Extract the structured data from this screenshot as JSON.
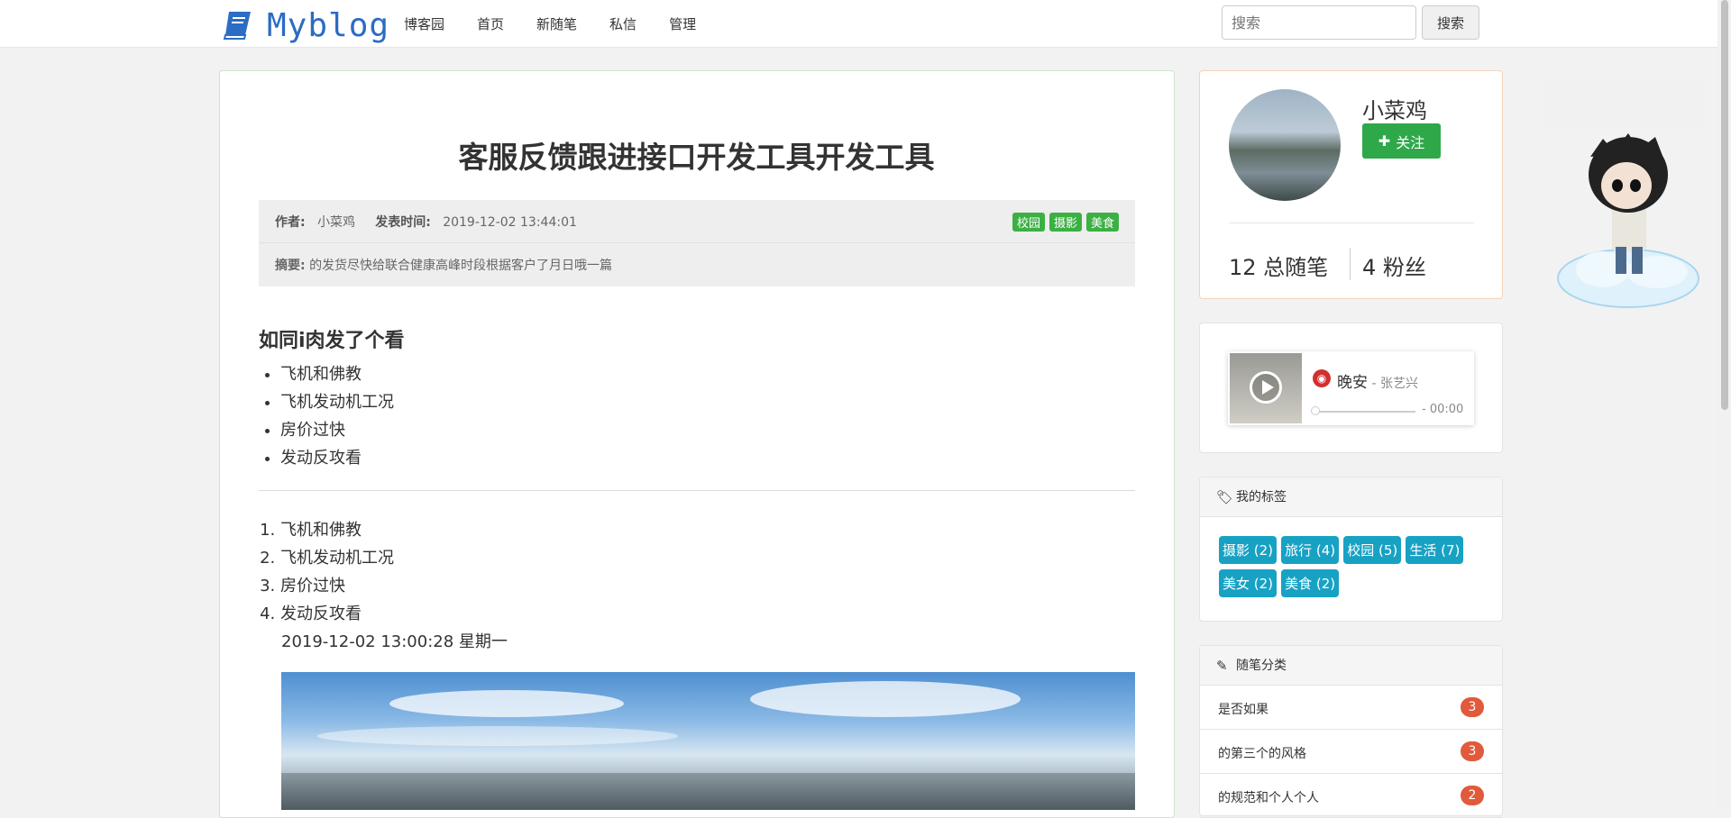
{
  "header": {
    "brand": "Myblog",
    "nav": [
      "博客园",
      "首页",
      "新随笔",
      "私信",
      "管理"
    ],
    "search_placeholder": "搜索",
    "search_button": "搜索"
  },
  "article": {
    "title": "客服反馈跟进接口开发工具开发工具",
    "author_label": "作者:",
    "author": "小菜鸡",
    "time_label": "发表时间:",
    "time": "2019-12-02 13:44:01",
    "tags": [
      "校园",
      "摄影",
      "美食"
    ],
    "summary_label": "摘要:",
    "summary": "的发货尽快给联合健康高峰时段根据客户了月日哦一篇",
    "heading": "如同i肉发了个看",
    "bullets": [
      "飞机和佛教",
      "飞机发动机工况",
      "房价过快",
      "发动反攻看"
    ],
    "ordered": [
      "飞机和佛教",
      "飞机发动机工况",
      "房价过快",
      "发动反攻看"
    ],
    "datetime": "2019-12-02 13:00:28 星期一"
  },
  "profile": {
    "name": "小菜鸡",
    "follow_label": "关注",
    "posts_stat": "12 总随笔",
    "fans_stat": "4 粉丝"
  },
  "music": {
    "song": "晚安",
    "artist": " - 张艺兴",
    "time": "- 00:00"
  },
  "tags_panel": {
    "title": "我的标签",
    "items": [
      "摄影 (2)",
      "旅行 (4)",
      "校园 (5)",
      "生活 (7)",
      "美女 (2)",
      "美食 (2)"
    ]
  },
  "categories_panel": {
    "title": "随笔分类",
    "items": [
      {
        "label": "是否如果",
        "count": "3"
      },
      {
        "label": "的第三个的风格",
        "count": "3"
      },
      {
        "label": "的规范和个人个人",
        "count": "2"
      }
    ]
  },
  "colors": {
    "brand": "#2b6cc4",
    "tag_green": "#3cb043",
    "follow_green": "#2fa84a",
    "tag_cyan": "#17a2c4",
    "badge_red": "#e05a3b"
  }
}
